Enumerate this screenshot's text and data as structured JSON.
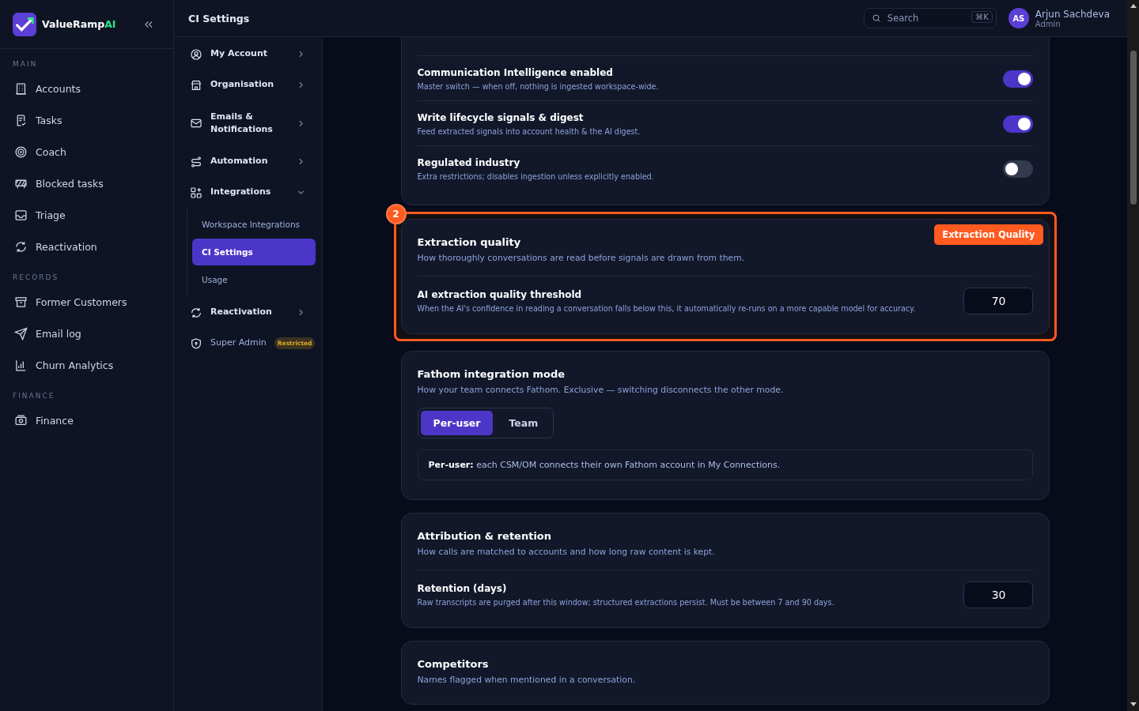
{
  "brand": {
    "name": "ValueRamp",
    "suffix": "AI"
  },
  "sidebar": {
    "sections": [
      {
        "label": "MAIN",
        "items": [
          {
            "label": "Accounts"
          },
          {
            "label": "Tasks"
          },
          {
            "label": "Coach"
          },
          {
            "label": "Blocked tasks"
          },
          {
            "label": "Triage"
          },
          {
            "label": "Reactivation"
          }
        ]
      },
      {
        "label": "RECORDS",
        "items": [
          {
            "label": "Former Customers"
          },
          {
            "label": "Email log"
          },
          {
            "label": "Churn Analytics"
          }
        ]
      },
      {
        "label": "FINANCE",
        "items": [
          {
            "label": "Finance"
          }
        ]
      }
    ]
  },
  "header": {
    "title": "CI Settings",
    "search": {
      "placeholder": "Search",
      "shortcut": "⌘K"
    },
    "user": {
      "initials": "AS",
      "name": "Arjun Sachdeva",
      "role": "Admin"
    }
  },
  "settings_nav": [
    {
      "label": "My Account",
      "expanded": false
    },
    {
      "label": "Organisation",
      "expanded": false
    },
    {
      "label": "Emails & Notifications",
      "expanded": false
    },
    {
      "label": "Automation",
      "expanded": false
    },
    {
      "label": "Integrations",
      "expanded": true,
      "children": [
        {
          "label": "Workspace Integrations",
          "selected": false
        },
        {
          "label": "CI Settings",
          "selected": true
        },
        {
          "label": "Usage",
          "selected": false
        }
      ]
    },
    {
      "label": "Reactivation",
      "expanded": false
    },
    {
      "label": "Super Admin",
      "badge": "Restricted"
    }
  ],
  "cards": [
    {
      "kind": "toggles",
      "rows": [
        {
          "title": "Communication Intelligence enabled",
          "description": "Master switch — when off, nothing is ingested workspace-wide.",
          "on": true
        },
        {
          "title": "Write lifecycle signals & digest",
          "description": "Feed extracted signals into account health & the AI digest.",
          "on": true
        },
        {
          "title": "Regulated industry",
          "description": "Extra restrictions; disables ingestion unless explicitly enabled.",
          "on": false
        }
      ]
    },
    {
      "kind": "field",
      "title": "Extraction quality",
      "description": "How thoroughly conversations are read before signals are drawn from them.",
      "highlight": {
        "badge": "2",
        "label": "Extraction Quality"
      },
      "field": {
        "label": "AI extraction quality threshold",
        "description": "When the AI's confidence in reading a conversation falls below this, it automatically re-runs on a more capable model for accuracy.",
        "value": "70"
      }
    },
    {
      "kind": "segmented",
      "title": "Fathom integration mode",
      "description": "How your team connects Fathom. Exclusive — switching disconnects the other mode.",
      "options": [
        {
          "label": "Per-user",
          "selected": true
        },
        {
          "label": "Team",
          "selected": false
        }
      ],
      "note": "**Per-user:** each CSM/OM connects their own Fathom account in My Connections."
    },
    {
      "kind": "field",
      "title": "Attribution & retention",
      "description": "How calls are matched to accounts and how long raw content is kept.",
      "field": {
        "label": "Retention (days)",
        "description": "Raw transcripts are purged after this window; structured extractions persist. Must be between 7 and 90 days.",
        "value": "30"
      }
    },
    {
      "kind": "plain",
      "title": "Competitors",
      "description": "Names flagged when mentioned in a conversation."
    }
  ]
}
